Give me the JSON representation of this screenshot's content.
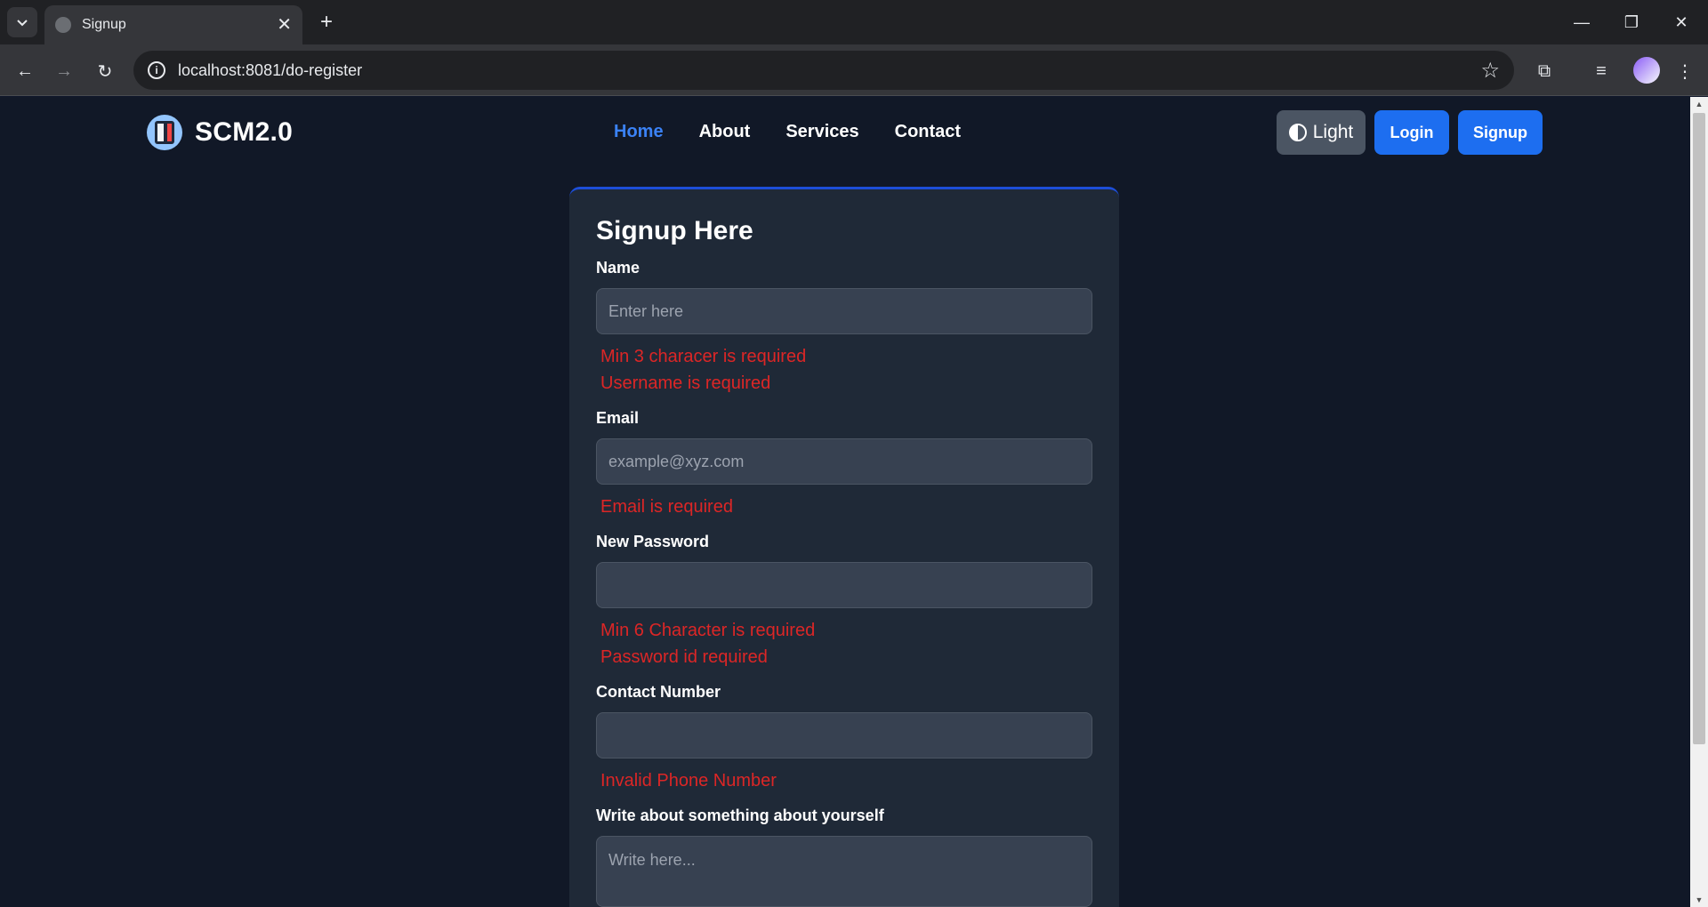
{
  "browser": {
    "tab_title": "Signup",
    "url": "localhost:8081/do-register"
  },
  "navbar": {
    "brand": "SCM2.0",
    "links": [
      "Home",
      "About",
      "Services",
      "Contact"
    ],
    "theme_button": "Light",
    "login_button": "Login",
    "signup_button": "Signup"
  },
  "form": {
    "title": "Signup Here",
    "name": {
      "label": "Name",
      "placeholder": "Enter here",
      "errors": [
        "Min 3 characer is required",
        "Username is required"
      ]
    },
    "email": {
      "label": "Email",
      "placeholder": "example@xyz.com",
      "errors": [
        "Email is required"
      ]
    },
    "password": {
      "label": "New Password",
      "placeholder": "",
      "errors": [
        "Min 6 Character is required",
        "Password id required"
      ]
    },
    "contact": {
      "label": "Contact Number",
      "placeholder": "",
      "errors": [
        "Invalid Phone Number"
      ]
    },
    "about": {
      "label": "Write about something about yourself",
      "placeholder": "Write here..."
    }
  },
  "colors": {
    "accent": "#1d6ef0",
    "error": "#dc2626",
    "background": "#111827"
  }
}
